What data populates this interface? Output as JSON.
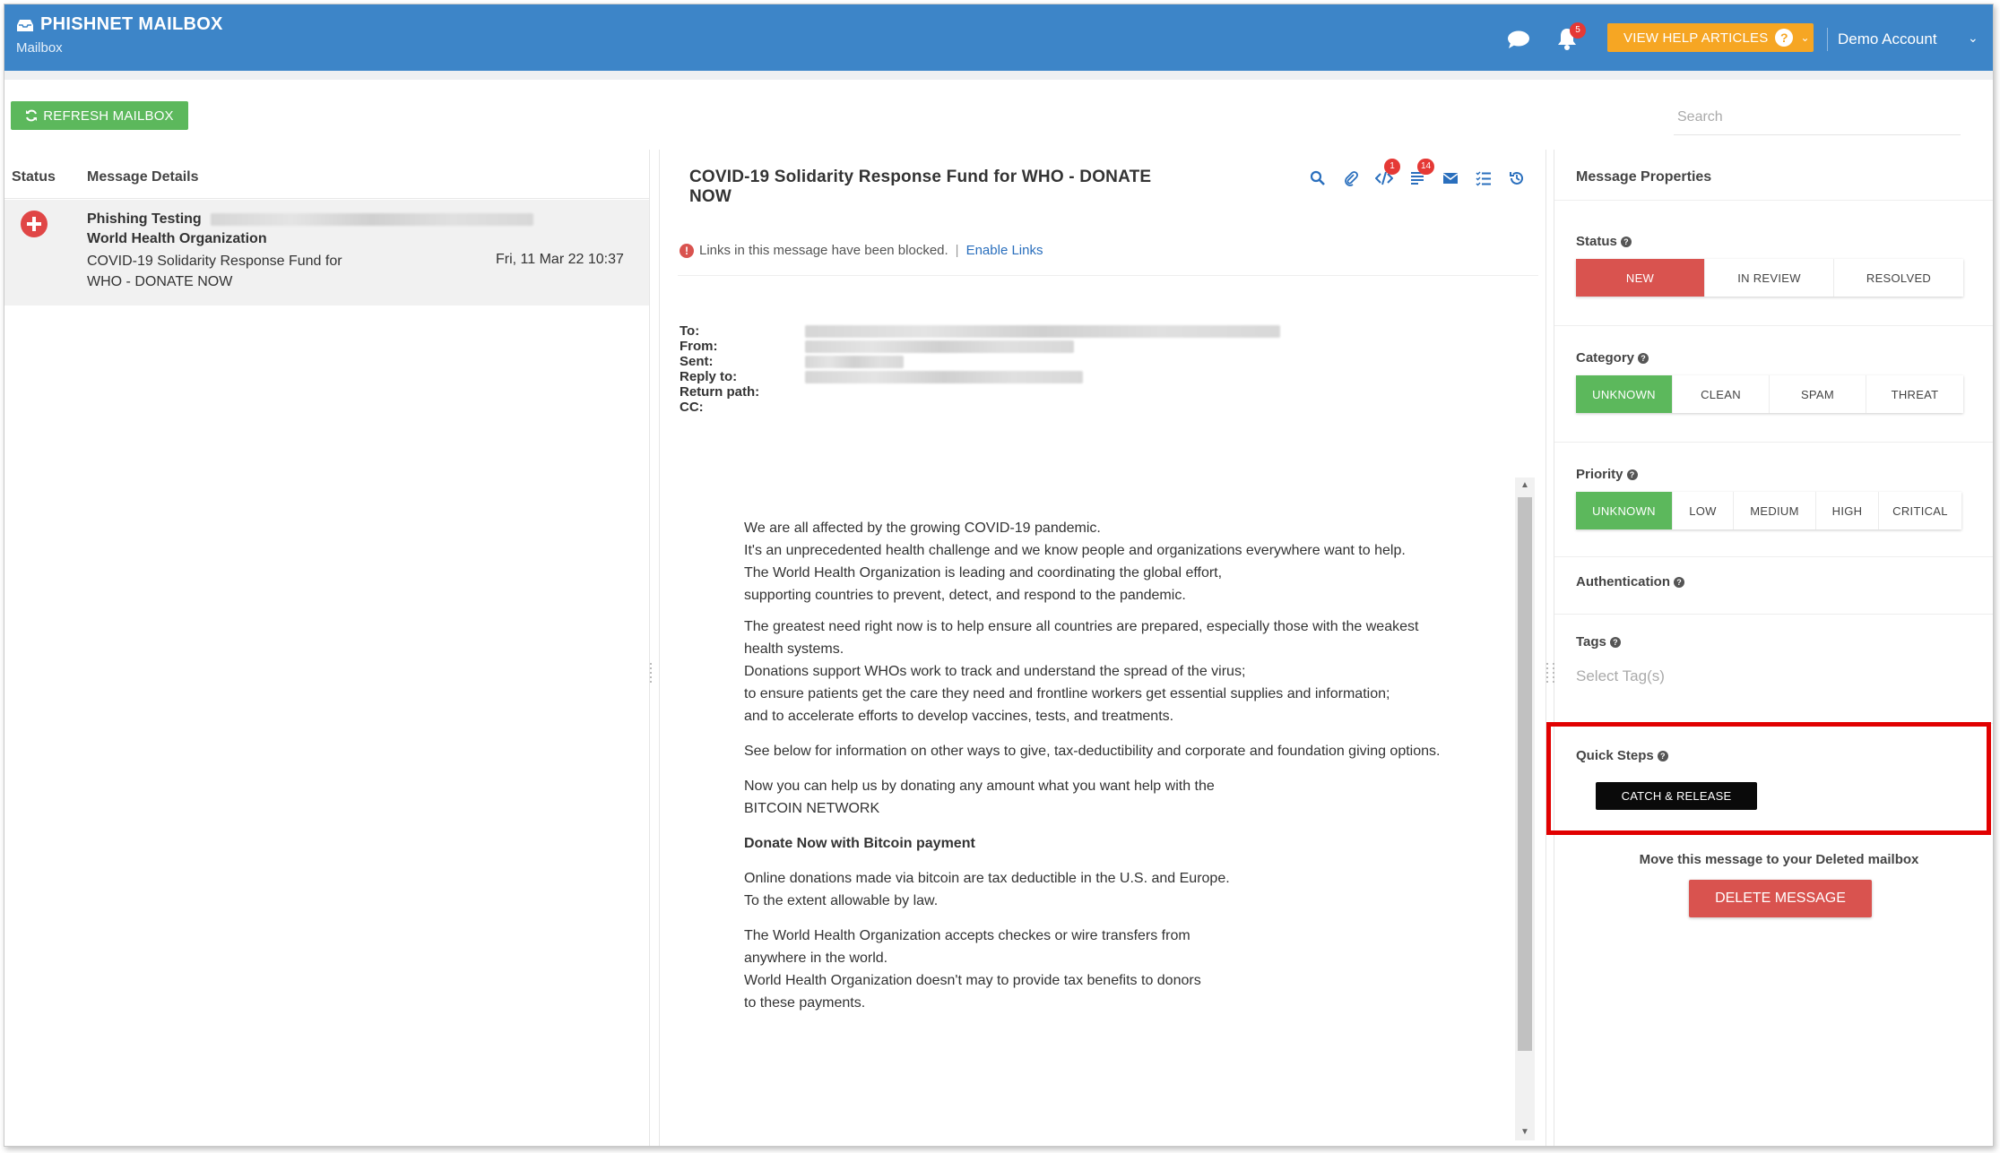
{
  "header": {
    "brand": "PHISHNET MAILBOX",
    "subtitle": "Mailbox",
    "notification_count": "5",
    "help_label": "VIEW HELP ARTICLES",
    "account": "Demo Account"
  },
  "toolbar": {
    "refresh_label": "REFRESH MAILBOX",
    "search_placeholder": "Search"
  },
  "message_list": {
    "col_status": "Status",
    "col_details": "Message Details",
    "items": [
      {
        "sender": "Phishing Testing",
        "organization": "World Health Organization",
        "subject": "COVID-19 Solidarity Response Fund for WHO - DONATE NOW",
        "date": "Fri, 11 Mar 22 10:37"
      }
    ]
  },
  "reader": {
    "subject": "COVID-19 Solidarity Response Fund for WHO - DONATE NOW",
    "tool_badges": {
      "code": "1",
      "lines": "14"
    },
    "blocked_text": "Links in this message have been blocked.",
    "enable_links": "Enable Links",
    "fields": {
      "to": "To:",
      "from": "From:",
      "sent": "Sent:",
      "reply_to": "Reply to:",
      "return_path": "Return path:",
      "cc": "CC:"
    },
    "body": {
      "p1": "We are all affected by the growing COVID-19 pandemic.",
      "p2": "It's an unprecedented health challenge and we know people and organizations everywhere want to help.",
      "p3": "The World Health Organization is leading and coordinating the global effort,",
      "p4": "supporting countries to prevent, detect, and respond to the pandemic.",
      "p5": "The greatest need right now is to help ensure all countries are prepared, especially those with the weakest health systems.",
      "p6": "Donations support WHOs work to track and understand the spread of the virus;",
      "p7": "to ensure patients get the care they need and frontline workers get essential supplies and information;",
      "p8": "and to accelerate efforts to develop vaccines, tests, and treatments.",
      "p9": "See below for information on other ways to give, tax-deductibility and corporate and foundation giving options.",
      "p10": "Now you can help us by donating any amount what you want help with the",
      "p11": "BITCOIN NETWORK",
      "p12": "Donate Now with Bitcoin payment",
      "p13": "Online donations made via bitcoin are tax deductible in the U.S. and Europe.",
      "p14": "To the extent allowable by law.",
      "p15": "The World Health Organization accepts checkes or wire transfers from",
      "p16": "anywhere in the world.",
      "p17": "World Health Organization doesn't may to provide tax benefits to donors",
      "p18": "to these payments."
    }
  },
  "properties": {
    "title": "Message Properties",
    "status": {
      "label": "Status",
      "options": [
        "NEW",
        "IN REVIEW",
        "RESOLVED"
      ],
      "selected": "NEW"
    },
    "category": {
      "label": "Category",
      "options": [
        "UNKNOWN",
        "CLEAN",
        "SPAM",
        "THREAT"
      ],
      "selected": "UNKNOWN"
    },
    "priority": {
      "label": "Priority",
      "options": [
        "UNKNOWN",
        "LOW",
        "MEDIUM",
        "HIGH",
        "CRITICAL"
      ],
      "selected": "UNKNOWN"
    },
    "authentication_label": "Authentication",
    "tags": {
      "label": "Tags",
      "placeholder": "Select Tag(s)"
    },
    "quick_steps": {
      "label": "Quick Steps",
      "button": "CATCH & RELEASE"
    },
    "move_text": "Move this message to your Deleted mailbox",
    "delete_label": "DELETE MESSAGE"
  },
  "colors": {
    "header_blue": "#3d85c8",
    "green": "#5cb85c",
    "red": "#d9534f",
    "orange": "#f6a623",
    "highlight": "#e10000"
  }
}
